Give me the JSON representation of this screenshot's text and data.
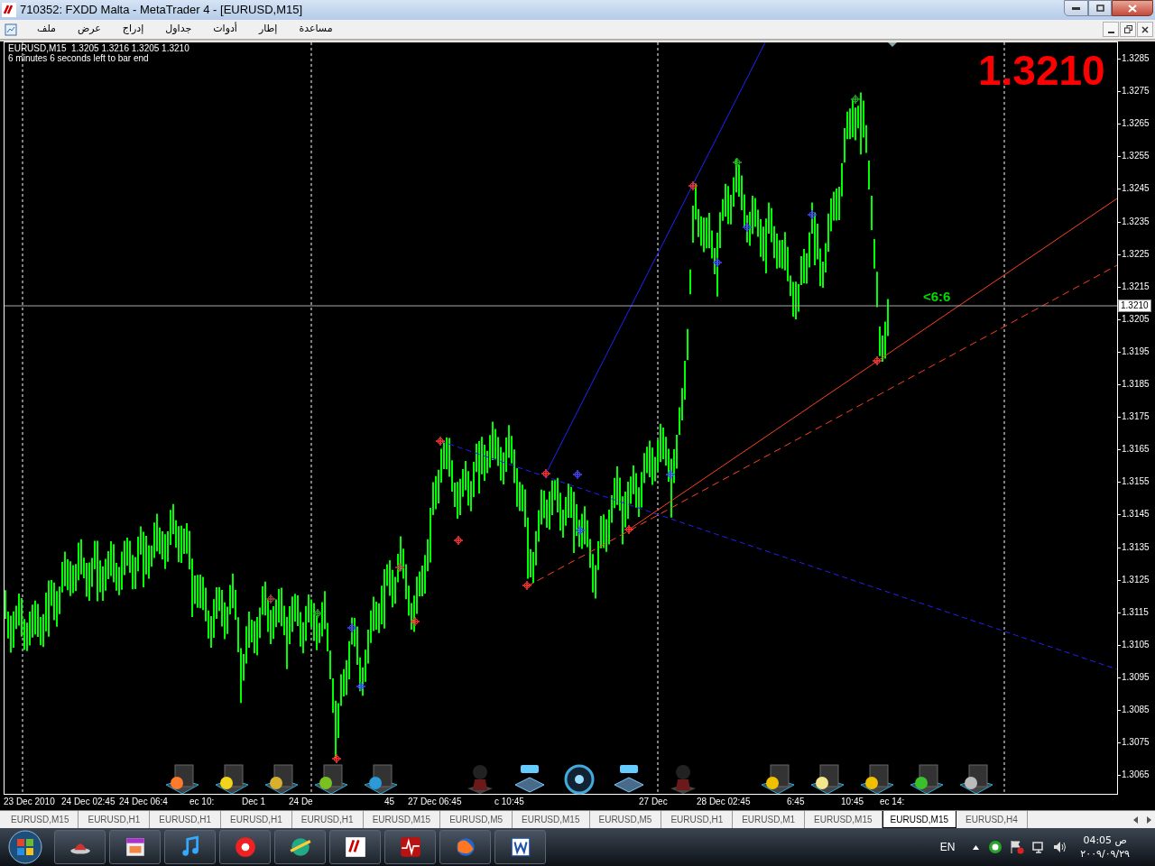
{
  "window": {
    "title": "710352: FXDD Malta - MetaTrader 4 - [EURUSD,M15]"
  },
  "menu": [
    "مساعدة",
    "إطار",
    "أدوات",
    "جداول",
    "إدراج",
    "عرض",
    "ملف"
  ],
  "chart": {
    "info_line": "EURUSD,M15  1.3205 1.3216 1.3205 1.3210",
    "countdown": "6 minutes 6 seconds left to bar end",
    "big_price": "1.3210",
    "timer_label": "<6:6",
    "price_ticks": [
      "1.3285",
      "1.3275",
      "1.3265",
      "1.3255",
      "1.3245",
      "1.3235",
      "1.3225",
      "1.3215",
      "1.3205",
      "1.3195",
      "1.3185",
      "1.3175",
      "1.3165",
      "1.3155",
      "1.3145",
      "1.3135",
      "1.3125",
      "1.3115",
      "1.3105",
      "1.3095",
      "1.3085",
      "1.3075",
      "1.3065"
    ],
    "current_price": "1.3210",
    "time_labels": [
      "23 Dec 2010",
      "24 Dec 02:45",
      "24 Dec 06:4",
      "ec 10:",
      "Dec 1",
      "24 De",
      "45",
      "27 Dec 06:45",
      "c 10:45",
      "27 Dec",
      "28 Dec 02:45",
      "6:45",
      "10:45",
      "ec 14:"
    ]
  },
  "tabs": [
    {
      "label": "EURUSD,M15",
      "selected": false
    },
    {
      "label": "EURUSD,H1",
      "selected": false
    },
    {
      "label": "EURUSD,H1",
      "selected": false
    },
    {
      "label": "EURUSD,H1",
      "selected": false
    },
    {
      "label": "EURUSD,H1",
      "selected": false
    },
    {
      "label": "EURUSD,M15",
      "selected": false
    },
    {
      "label": "EURUSD,M5",
      "selected": false
    },
    {
      "label": "EURUSD,M15",
      "selected": false
    },
    {
      "label": "EURUSD,M5",
      "selected": false
    },
    {
      "label": "EURUSD,H1",
      "selected": false
    },
    {
      "label": "EURUSD,M1",
      "selected": false
    },
    {
      "label": "EURUSD,M15",
      "selected": false
    },
    {
      "label": "EURUSD,M15",
      "selected": true
    },
    {
      "label": "EURUSD,H4",
      "selected": false
    }
  ],
  "taskbar": {
    "language": "EN",
    "time": "04:05 ص",
    "date": "٢٠٠٩/٠٩/٢٩"
  }
}
